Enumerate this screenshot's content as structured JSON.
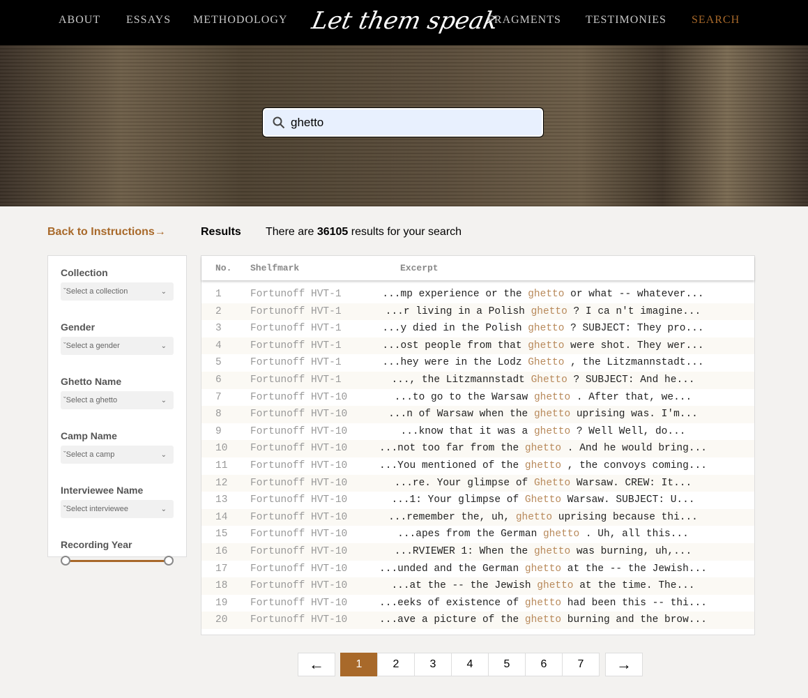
{
  "nav": {
    "items": [
      "ABOUT",
      "ESSAYS",
      "METHODOLOGY",
      "FRAGMENTS",
      "TESTIMONIES",
      "SEARCH"
    ],
    "logo": "Let them speak",
    "active": "SEARCH",
    "active_color": "#a8692a"
  },
  "search": {
    "value": "ghetto",
    "icon": "search-icon"
  },
  "sidebar": {
    "back_label": "Back to Instructions→",
    "filters": [
      {
        "label": "Collection",
        "placeholder": "Select a collection"
      },
      {
        "label": "Gender",
        "placeholder": "Select a gender"
      },
      {
        "label": "Ghetto Name",
        "placeholder": "Select a ghetto"
      },
      {
        "label": "Camp Name",
        "placeholder": "Select a camp"
      },
      {
        "label": "Interviewee Name",
        "placeholder": "Select interviewee"
      }
    ],
    "year_label": "Recording Year"
  },
  "results": {
    "title": "Results",
    "count_prefix": "There are ",
    "count": "36105",
    "count_suffix": " results for your search",
    "columns": [
      "No.",
      "Shelfmark",
      "Excerpt"
    ],
    "rows": [
      {
        "n": "1",
        "s": "Fortunoff HVT-1",
        "pre": "...mp experience or the ",
        "k": "ghetto",
        "post": " or what -- whatever..."
      },
      {
        "n": "2",
        "s": "Fortunoff HVT-1",
        "pre": "...r living in a Polish ",
        "k": "ghetto",
        "post": " ? I ca n't imagine..."
      },
      {
        "n": "3",
        "s": "Fortunoff HVT-1",
        "pre": "...y died in the Polish ",
        "k": "ghetto",
        "post": " ? SUBJECT: They pro..."
      },
      {
        "n": "4",
        "s": "Fortunoff HVT-1",
        "pre": "...ost people from that ",
        "k": "ghetto",
        "post": " were shot. They wer..."
      },
      {
        "n": "5",
        "s": "Fortunoff HVT-1",
        "pre": "...hey were in the Lodz ",
        "k": "Ghetto",
        "post": " , the Litzmannstadt..."
      },
      {
        "n": "6",
        "s": "Fortunoff HVT-1",
        "pre": "..., the Litzmannstadt ",
        "k": "Ghetto",
        "post": " ? SUBJECT: And he..."
      },
      {
        "n": "7",
        "s": "Fortunoff HVT-10",
        "pre": "...to go to the Warsaw ",
        "k": "ghetto",
        "post": " . After that, we..."
      },
      {
        "n": "8",
        "s": "Fortunoff HVT-10",
        "pre": "...n of Warsaw when the ",
        "k": "ghetto",
        "post": " uprising was. I'm..."
      },
      {
        "n": "9",
        "s": "Fortunoff HVT-10",
        "pre": "...know that it was a ",
        "k": "ghetto",
        "post": " ? Well Well, do..."
      },
      {
        "n": "10",
        "s": "Fortunoff HVT-10",
        "pre": "...not too far from the ",
        "k": "ghetto",
        "post": " . And he would bring..."
      },
      {
        "n": "11",
        "s": "Fortunoff HVT-10",
        "pre": "...You mentioned of the ",
        "k": "ghetto",
        "post": " , the convoys coming..."
      },
      {
        "n": "12",
        "s": "Fortunoff HVT-10",
        "pre": "...re. Your glimpse of ",
        "k": "Ghetto",
        "post": " Warsaw. CREW: It..."
      },
      {
        "n": "13",
        "s": "Fortunoff HVT-10",
        "pre": "...1: Your glimpse of ",
        "k": "Ghetto",
        "post": " Warsaw. SUBJECT: U..."
      },
      {
        "n": "14",
        "s": "Fortunoff HVT-10",
        "pre": "...remember the, uh, ",
        "k": "ghetto",
        "post": " uprising because thi..."
      },
      {
        "n": "15",
        "s": "Fortunoff HVT-10",
        "pre": "...apes from the German ",
        "k": "ghetto",
        "post": " . Uh, all this..."
      },
      {
        "n": "16",
        "s": "Fortunoff HVT-10",
        "pre": "...RVIEWER 1: When the ",
        "k": "ghetto",
        "post": " was burning, uh,..."
      },
      {
        "n": "17",
        "s": "Fortunoff HVT-10",
        "pre": "...unded and the German ",
        "k": "ghetto",
        "post": " at the -- the Jewish..."
      },
      {
        "n": "18",
        "s": "Fortunoff HVT-10",
        "pre": "...at the -- the Jewish ",
        "k": "ghetto",
        "post": " at the time. The..."
      },
      {
        "n": "19",
        "s": "Fortunoff HVT-10",
        "pre": "...eeks of existence of ",
        "k": "ghetto",
        "post": " had been this -- thi..."
      },
      {
        "n": "20",
        "s": "Fortunoff HVT-10",
        "pre": "...ave a picture of the ",
        "k": "ghetto",
        "post": " burning and the brow..."
      }
    ]
  },
  "pagination": {
    "prev": "←",
    "next": "→",
    "pages": [
      "1",
      "2",
      "3",
      "4",
      "5",
      "6",
      "7"
    ],
    "current": "1"
  }
}
